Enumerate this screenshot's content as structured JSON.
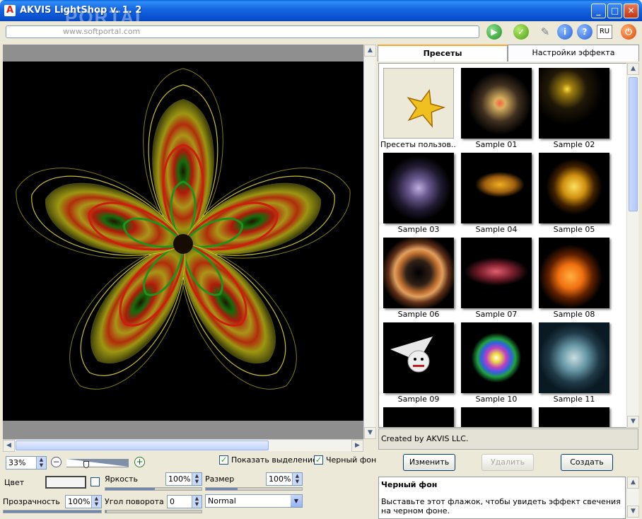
{
  "window": {
    "title": "AKVIS LightShop v. 1. 2",
    "watermark": "PORTAL",
    "url_text": "www.softportal.com"
  },
  "toolbar": {
    "language": "RU"
  },
  "zoom": {
    "value": "33%"
  },
  "checks": {
    "show_selection": "Показать выделение",
    "black_bg": "Черный фон"
  },
  "controls": {
    "color_label": "Цвет",
    "brightness_label": "Яркость",
    "brightness_value": "100%",
    "size_label": "Размер",
    "size_value": "100%",
    "opacity_label": "Прозрачность",
    "opacity_value": "100%",
    "angle_label": "Угол поворота",
    "angle_value": "0",
    "blend_mode": "Normal"
  },
  "tabs": {
    "presets": "Пресеты",
    "effect_settings": "Настройки эффекта"
  },
  "presets": [
    "Пресеты пользов...",
    "Sample 01",
    "Sample 02",
    "Sample 03",
    "Sample 04",
    "Sample 05",
    "Sample 06",
    "Sample 07",
    "Sample 08",
    "Sample 09",
    "Sample 10",
    "Sample 11"
  ],
  "created_by": "Created by AKVIS LLC.",
  "buttons": {
    "edit": "Изменить",
    "delete": "Удалить",
    "create": "Создать"
  },
  "description": {
    "title": "Черный фон",
    "text": "Выставьте этот флажок, чтобы увидеть эффект свечения на черном фоне."
  }
}
